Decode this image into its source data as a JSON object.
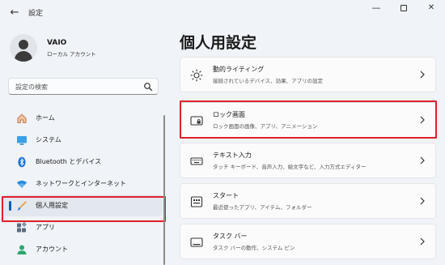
{
  "window": {
    "title": "設定",
    "back_glyph": "←",
    "controls": {
      "minimize": "—",
      "close": "✕"
    }
  },
  "user": {
    "name": "VAIO",
    "account_type": "ローカル アカウント"
  },
  "search": {
    "placeholder": "設定の検索"
  },
  "sidebar": {
    "items": [
      {
        "label": "ホーム",
        "icon": "home-icon",
        "active": false
      },
      {
        "label": "システム",
        "icon": "system-icon",
        "active": false
      },
      {
        "label": "Bluetooth とデバイス",
        "icon": "bluetooth-icon",
        "active": false
      },
      {
        "label": "ネットワークとインターネット",
        "icon": "network-icon",
        "active": false
      },
      {
        "label": "個人用設定",
        "icon": "brush-icon",
        "active": true
      },
      {
        "label": "アプリ",
        "icon": "apps-icon",
        "active": false
      },
      {
        "label": "アカウント",
        "icon": "account-icon",
        "active": false
      }
    ]
  },
  "main": {
    "title": "個人用設定",
    "cards": [
      {
        "title": "動的ライティング",
        "subtitle": "接続されているデバイス、効果、アプリの設定",
        "icon": "dynamic-lighting-icon"
      },
      {
        "title": "ロック画面",
        "subtitle": "ロック画面の画像、アプリ、アニメーション",
        "icon": "lock-screen-icon"
      },
      {
        "title": "テキスト入力",
        "subtitle": "タッチ キーボード、音声入力、絵文字など、入力方式エディター",
        "icon": "keyboard-icon"
      },
      {
        "title": "スタート",
        "subtitle": "最近使ったアプリ、アイテム、フォルダー",
        "icon": "start-icon"
      },
      {
        "title": "タスク バー",
        "subtitle": "タスク バーの動作、システム ピン",
        "icon": "taskbar-icon"
      }
    ]
  },
  "colors": {
    "accent": "#005fb8",
    "highlight": "#e0202a",
    "background": "#f0f3f8"
  }
}
